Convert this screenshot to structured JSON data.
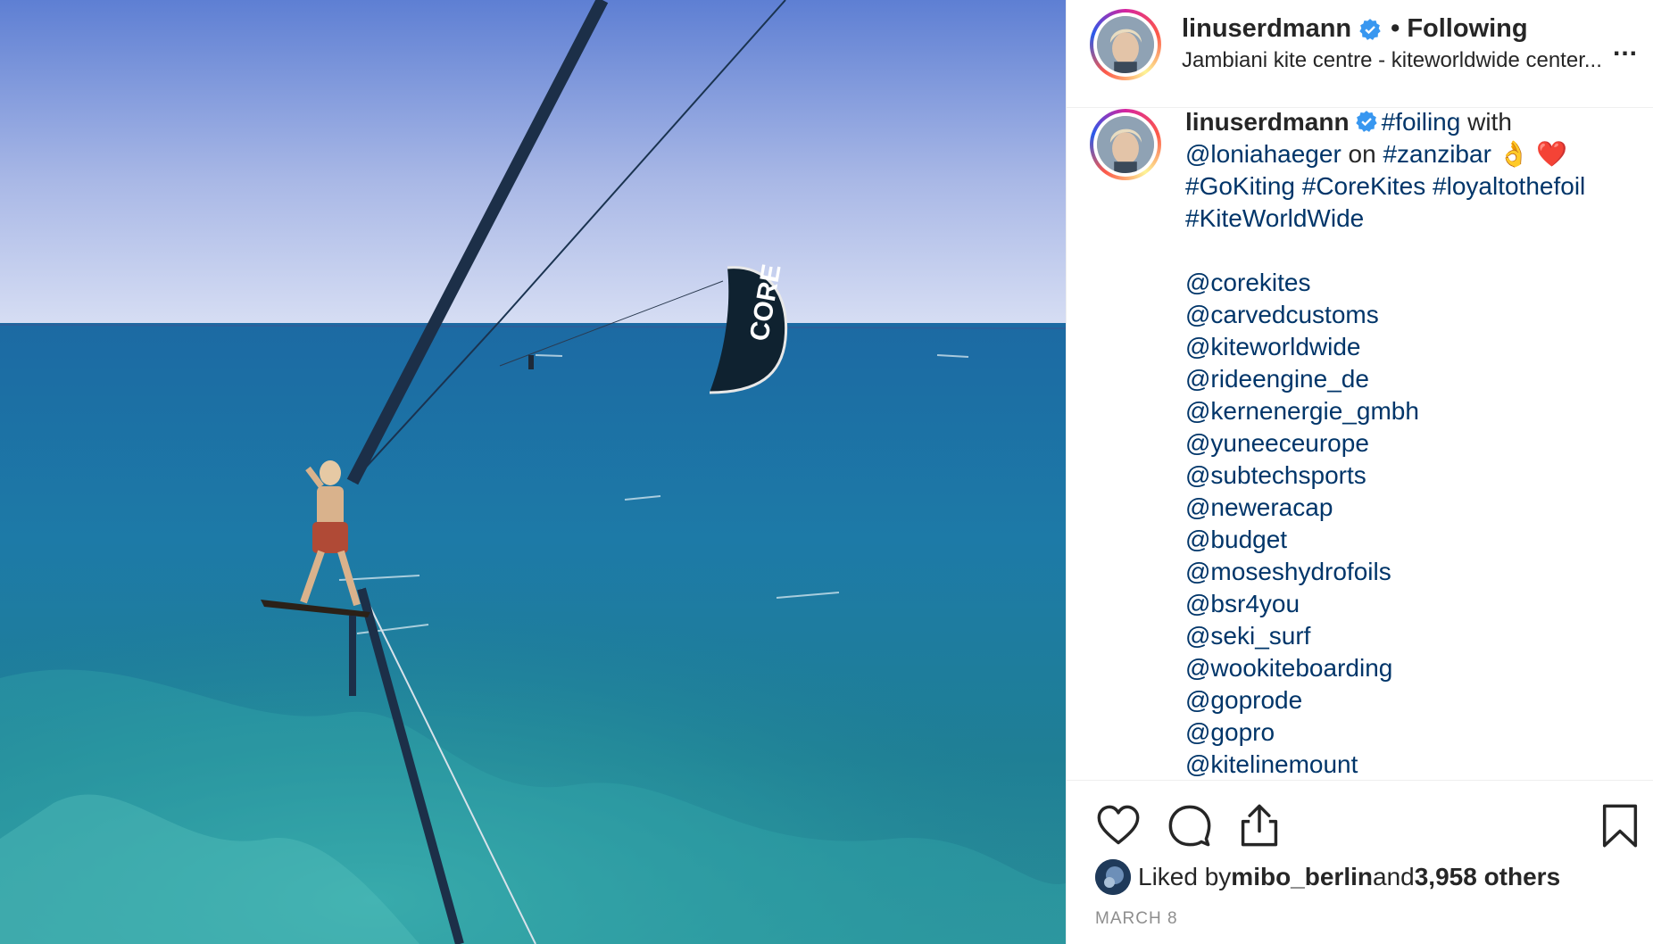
{
  "post": {
    "username": "linuserdmann",
    "follow_separator": "•",
    "follow_status": "Following",
    "location": "Jambiani kite centre - kiteworldwide center...",
    "more_label": "...",
    "image_text": "CORE"
  },
  "caption": {
    "username": "linuserdmann",
    "t1": "#foiling",
    "t2": " with ",
    "t3": "@loniahaeger",
    "t4": " on ",
    "t5": "#zanzibar",
    "t6": " 👌 ❤️",
    "t7": "#GoKiting #CoreKites #loyaltothefoil #KiteWorldWide",
    "mentions": [
      "@corekites",
      "@carvedcustoms",
      "@kiteworldwide",
      "@rideengine_de",
      "@kernenergie_gmbh",
      "@yuneeceurope",
      "@subtechsports",
      "@neweracap",
      "@budget",
      "@moseshydrofoils",
      "@bsr4you",
      "@seki_surf",
      "@wookiteboarding",
      "@goprode",
      "@gopro",
      "@kitelinemount"
    ]
  },
  "likes": {
    "prefix": "Liked by ",
    "user": "mibo_berlin",
    "middle": " and ",
    "count": "3,958 others"
  },
  "date": "MARCH 8",
  "colors": {
    "link": "#003569",
    "text": "#262626",
    "muted": "#8e8e8e",
    "verified": "#3897f0"
  },
  "icons": [
    "heart-icon",
    "comment-icon",
    "share-icon",
    "bookmark-icon",
    "verified-badge-icon"
  ]
}
